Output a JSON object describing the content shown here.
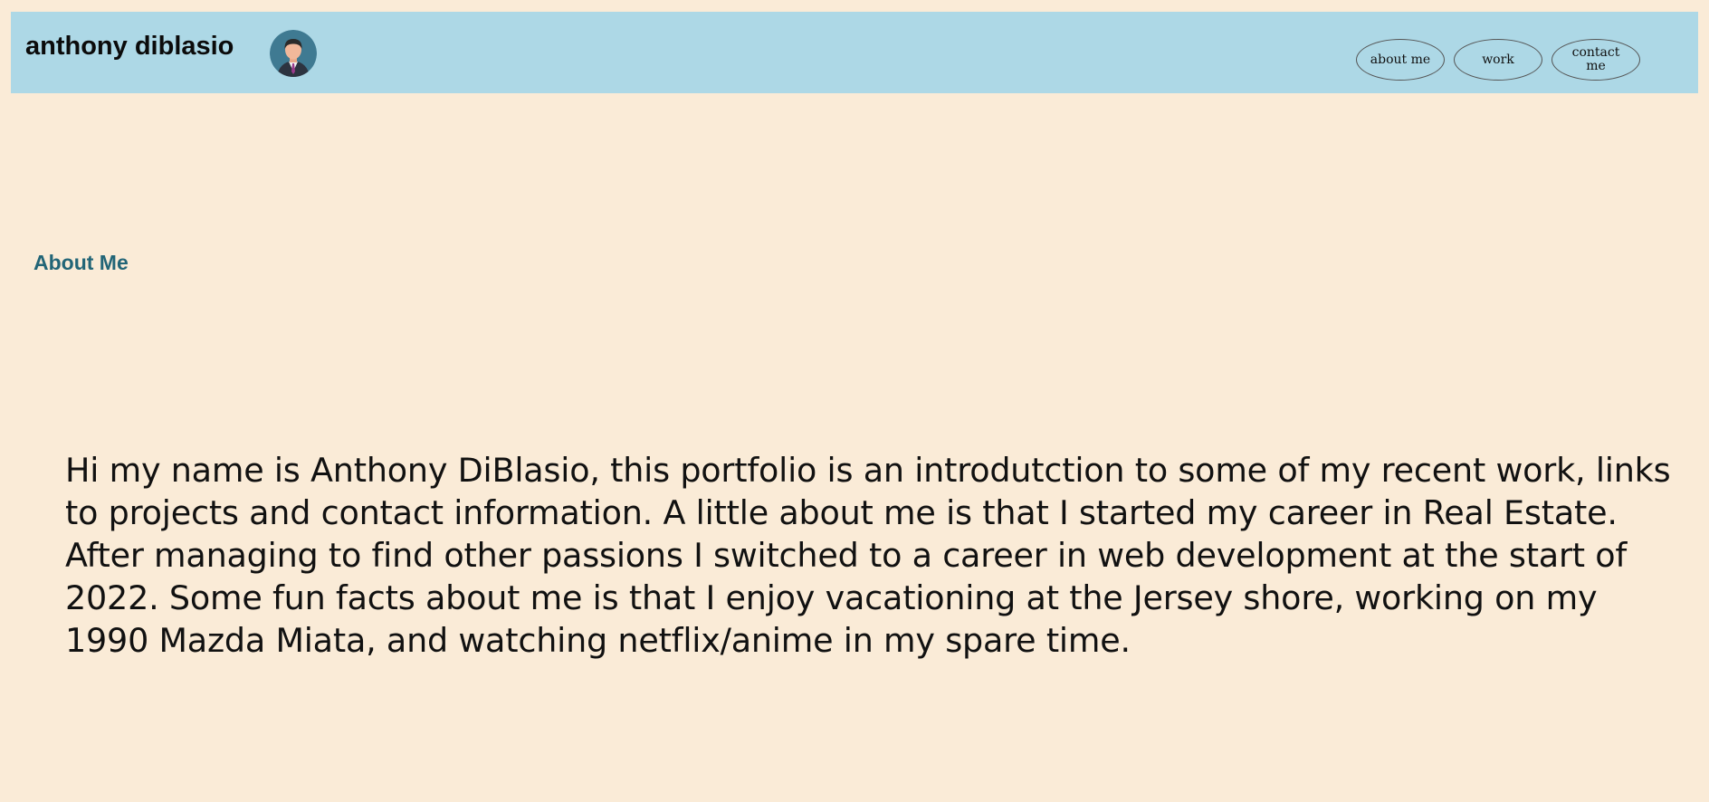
{
  "header": {
    "title": "anthony diblasio",
    "avatar_icon": "person-avatar-icon",
    "background": "#add8e6"
  },
  "nav": {
    "items": [
      {
        "label": "about me"
      },
      {
        "label": "work"
      },
      {
        "label": "contact me"
      }
    ]
  },
  "main": {
    "heading": "About Me",
    "bio": "Hi my name is Anthony DiBlasio, this portfolio is an introdutction to some of my recent work, links to projects and contact information. A little about me is that I started my career in Real Estate. After managing to find other passions I switched to a career in web development at the start of 2022. Some fun facts about me is that I enjoy vacationing at the Jersey shore, working on my 1990 Mazda Miata, and watching netflix/anime in my spare time."
  },
  "colors": {
    "page_background": "#faebd7",
    "heading_color": "#226577"
  }
}
